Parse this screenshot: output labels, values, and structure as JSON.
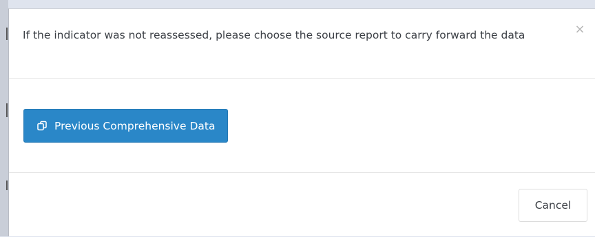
{
  "modal": {
    "title": "If the indicator was not reassessed, please choose the source report to carry forward the data",
    "close_label": "×",
    "primary_button": {
      "label": "Previous Comprehensive Data",
      "icon": "copy-icon"
    },
    "cancel_label": "Cancel"
  },
  "colors": {
    "primary": "#2a87c8",
    "backdrop": "#dfe4ee"
  }
}
